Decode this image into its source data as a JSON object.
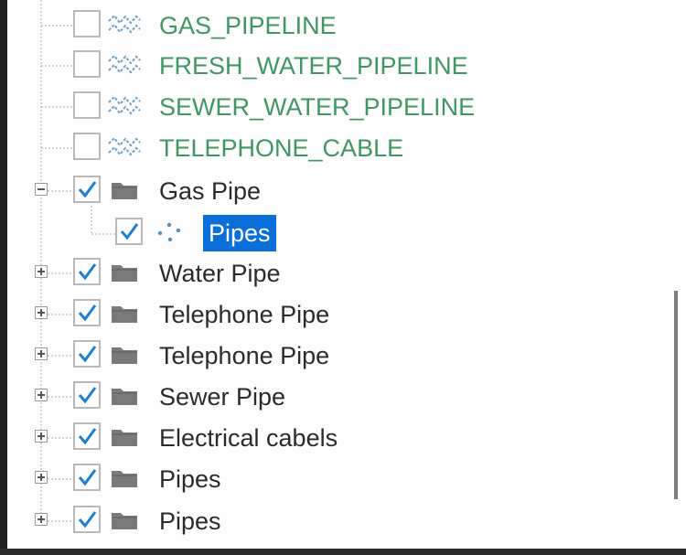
{
  "tree": {
    "items": [
      {
        "label": "GAS_PIPELINE",
        "checked": false,
        "icon": "line-feature-icon"
      },
      {
        "label": "FRESH_WATER_PIPELINE",
        "checked": false,
        "icon": "line-feature-icon"
      },
      {
        "label": "SEWER_WATER_PIPELINE",
        "checked": false,
        "icon": "line-feature-icon"
      },
      {
        "label": "TELEPHONE_CABLE",
        "checked": false,
        "icon": "line-feature-icon"
      },
      {
        "label": "Gas Pipe",
        "checked": true,
        "icon": "folder-icon",
        "expanded": true
      },
      {
        "label": "Pipes",
        "checked": true,
        "icon": "point-feature-icon",
        "selected": true
      },
      {
        "label": "Water Pipe",
        "checked": true,
        "icon": "folder-icon",
        "expanded": false
      },
      {
        "label": "Telephone Pipe",
        "checked": true,
        "icon": "folder-icon",
        "expanded": false
      },
      {
        "label": "Telephone Pipe",
        "checked": true,
        "icon": "folder-icon",
        "expanded": false
      },
      {
        "label": "Sewer Pipe",
        "checked": true,
        "icon": "folder-icon",
        "expanded": false
      },
      {
        "label": "Electrical cabels",
        "checked": true,
        "icon": "folder-icon",
        "expanded": false
      },
      {
        "label": "Pipes",
        "checked": true,
        "icon": "folder-icon",
        "expanded": false
      },
      {
        "label": "Pipes",
        "checked": true,
        "icon": "folder-icon",
        "expanded": false
      }
    ]
  },
  "colors": {
    "feature_label": "#3f9863",
    "selection": "#0a6fd8",
    "checkmark": "#1e7fd0"
  }
}
